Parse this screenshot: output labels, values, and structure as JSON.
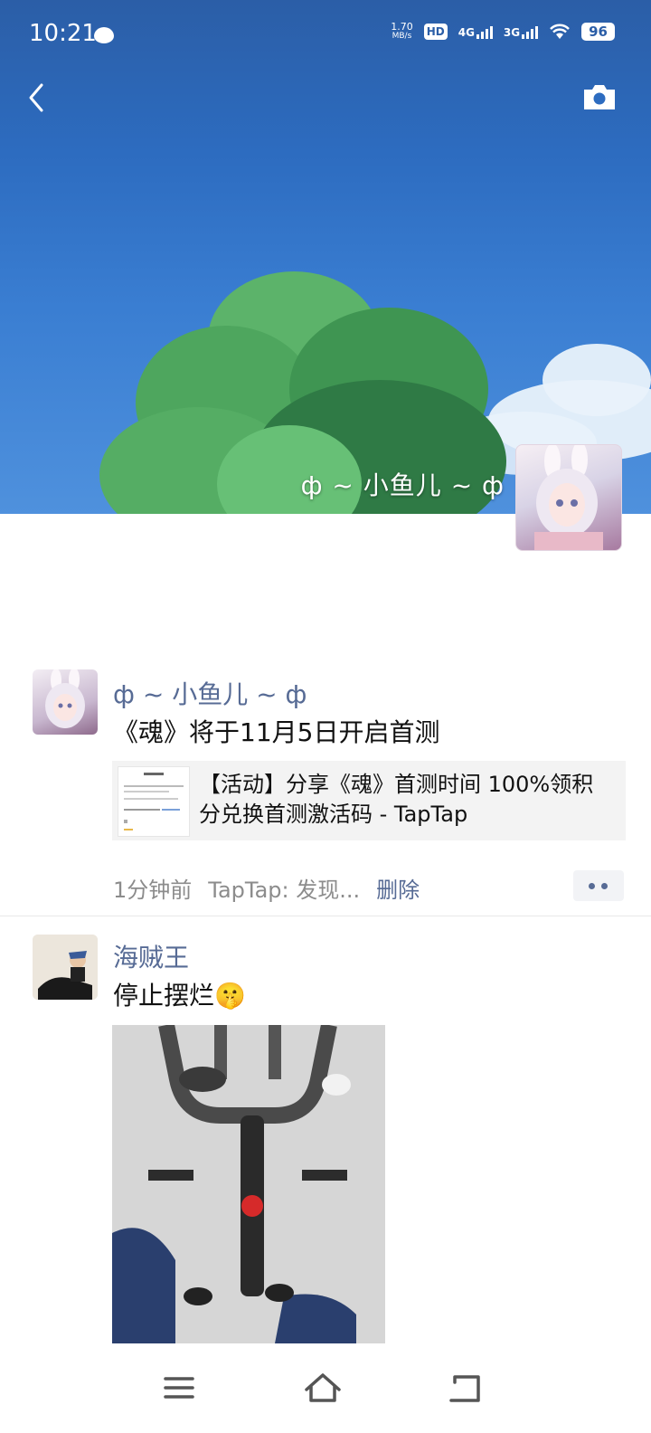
{
  "status_bar": {
    "time": "10:21",
    "net_speed_value": "1.70",
    "net_speed_unit": "MB/s",
    "hd_label": "HD",
    "sim1_label": "4G",
    "sim2_label": "3G",
    "battery": "96"
  },
  "cover": {
    "nickname": "ф ~ 小鱼儿 ~ ф"
  },
  "posts": [
    {
      "author": "ф ~ 小鱼儿 ~ ф",
      "text": "《魂》将于11月5日开启首测",
      "link_title": "【活动】分享《魂》首测时间 100%领积分兑换首测激活码 - TapTap",
      "time": "1分钟前",
      "source": "TapTap: 发现...",
      "delete_label": "删除"
    },
    {
      "author": "海贼王",
      "text": "停止摆烂🤫"
    }
  ],
  "colors": {
    "name_link": "#576b95",
    "cover_sky": "#2d6cc0"
  },
  "icons": [
    "back-icon",
    "camera-icon",
    "more-icon",
    "menu-icon",
    "home-icon",
    "return-icon"
  ]
}
